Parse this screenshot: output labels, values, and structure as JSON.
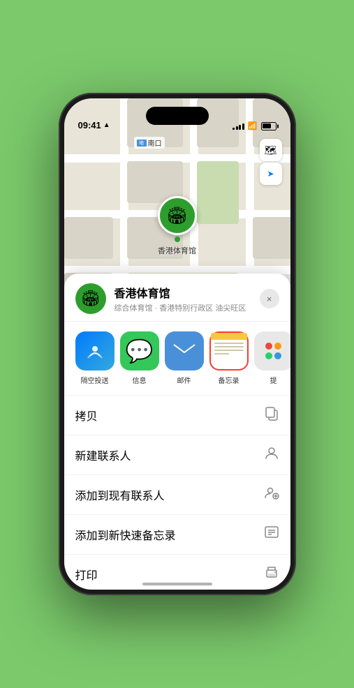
{
  "status_bar": {
    "time": "09:41",
    "location_arrow": "▶"
  },
  "map": {
    "label_text": "南口",
    "pin_label": "香港体育馆",
    "pin_emoji": "🏟"
  },
  "map_controls": {
    "map_btn": "🗺",
    "location_btn": "➤"
  },
  "venue_card": {
    "name": "香港体育馆",
    "subtitle": "综合体育馆 · 香港特别行政区 油尖旺区",
    "close_label": "×"
  },
  "share_items": [
    {
      "id": "airdrop",
      "label": "隔空投送",
      "type": "airdrop"
    },
    {
      "id": "message",
      "label": "信息",
      "type": "message"
    },
    {
      "id": "mail",
      "label": "邮件",
      "type": "mail"
    },
    {
      "id": "notes",
      "label": "备忘录",
      "type": "notes"
    },
    {
      "id": "more",
      "label": "提",
      "type": "more"
    }
  ],
  "actions": [
    {
      "id": "copy",
      "label": "拷贝",
      "icon": "copy"
    },
    {
      "id": "new-contact",
      "label": "新建联系人",
      "icon": "person"
    },
    {
      "id": "add-contact",
      "label": "添加到现有联系人",
      "icon": "person-plus"
    },
    {
      "id": "quick-notes",
      "label": "添加到新快速备忘录",
      "icon": "quick-note"
    },
    {
      "id": "print",
      "label": "打印",
      "icon": "printer"
    }
  ]
}
